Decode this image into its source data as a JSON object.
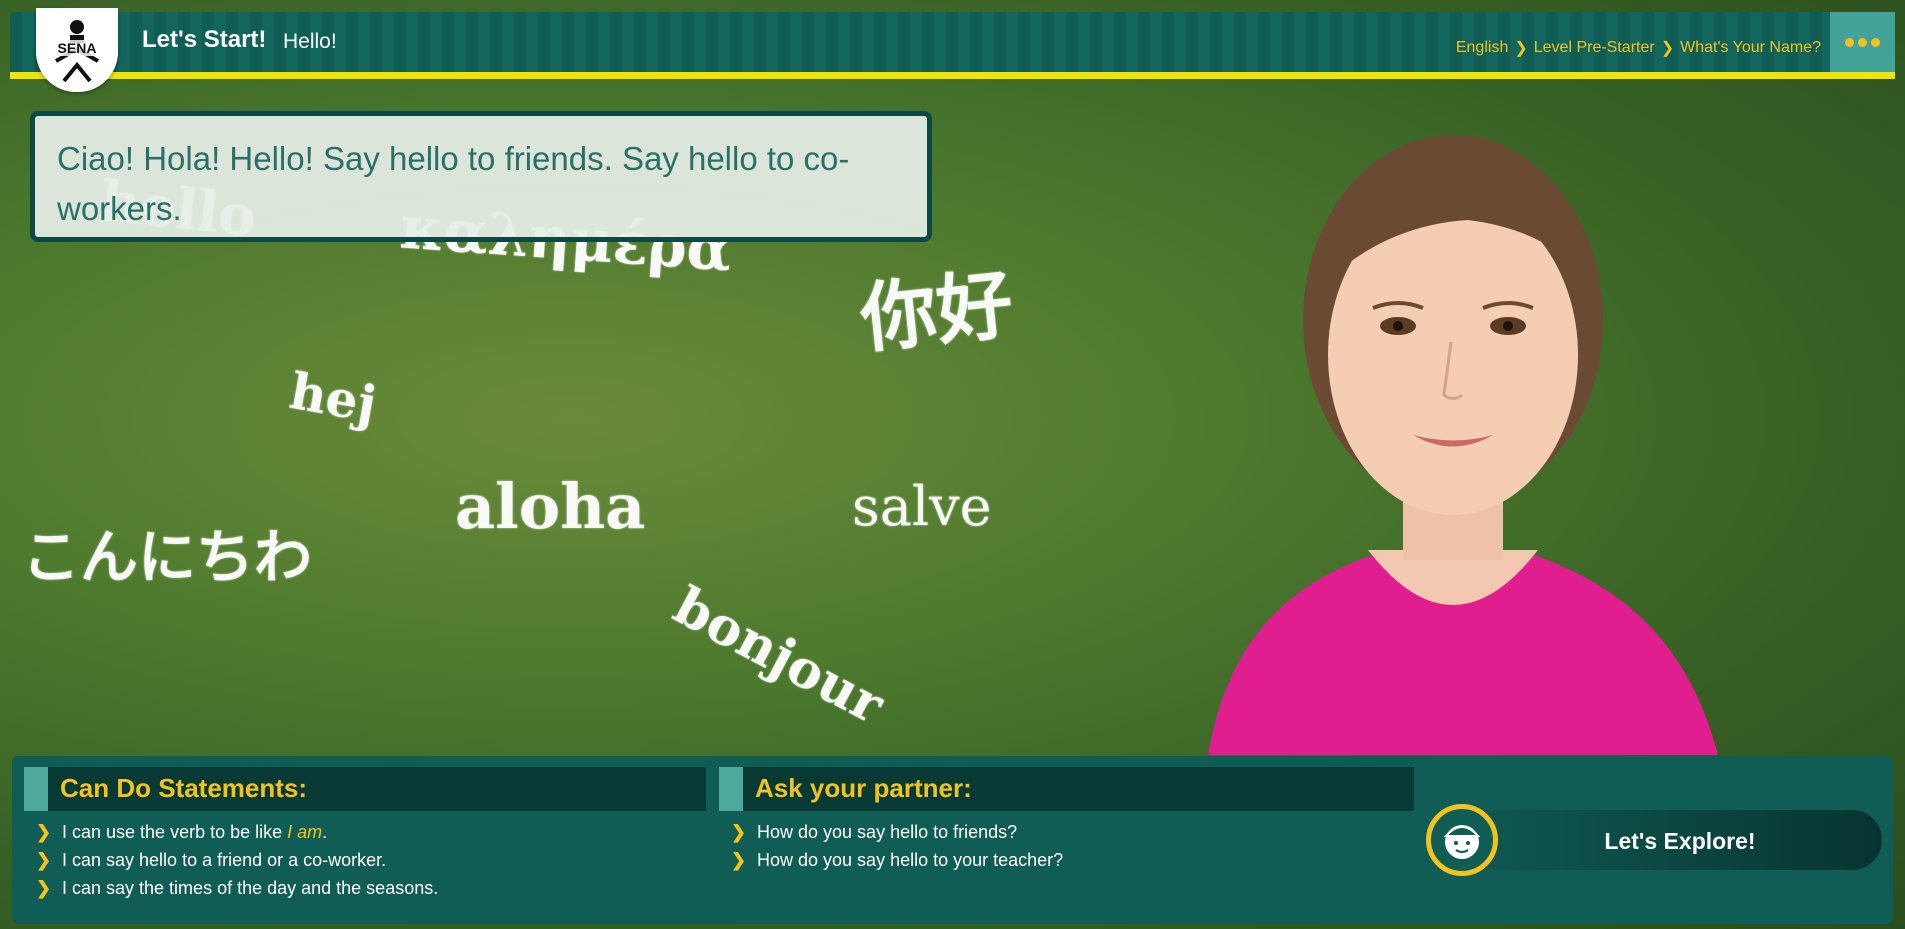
{
  "header": {
    "logo_text": "SENA",
    "title": "Let's Start!",
    "subtitle": "Hello!",
    "breadcrumb": [
      "English",
      "Level Pre-Starter",
      "What's Your Name?"
    ]
  },
  "speech_bubble": {
    "text": "Ciao! Hola! Hello! Say hello to friends. Say hello to co-workers."
  },
  "chalkboard_words": [
    "hello",
    "καλημέρα",
    "你好",
    "hej",
    "aloha",
    "salve",
    "こんにちわ",
    "bonjour"
  ],
  "can_do": {
    "title": "Can Do Statements:",
    "item1_before": "I can use the verb to be like ",
    "item1_em": "I am",
    "item1_after": ".",
    "item2": "I can say hello to a friend or a co-worker.",
    "item3": "I can say the times of the day and the seasons."
  },
  "ask_partner": {
    "title": "Ask your partner:",
    "items": [
      "How do you say hello to friends?",
      "How do you say hello to your teacher?"
    ]
  },
  "explore": {
    "label": "Let's Explore!"
  },
  "colors": {
    "teal": "#0f5d55",
    "dark_teal": "#083a35",
    "accent_yellow": "#f4c21c",
    "bar_yellow": "#f0e400",
    "shirt_pink": "#e01e8f"
  },
  "icons": {
    "menu": "more-dots-icon",
    "list_bullet": "chevron-right-icon",
    "explore": "student-avatar-icon"
  }
}
